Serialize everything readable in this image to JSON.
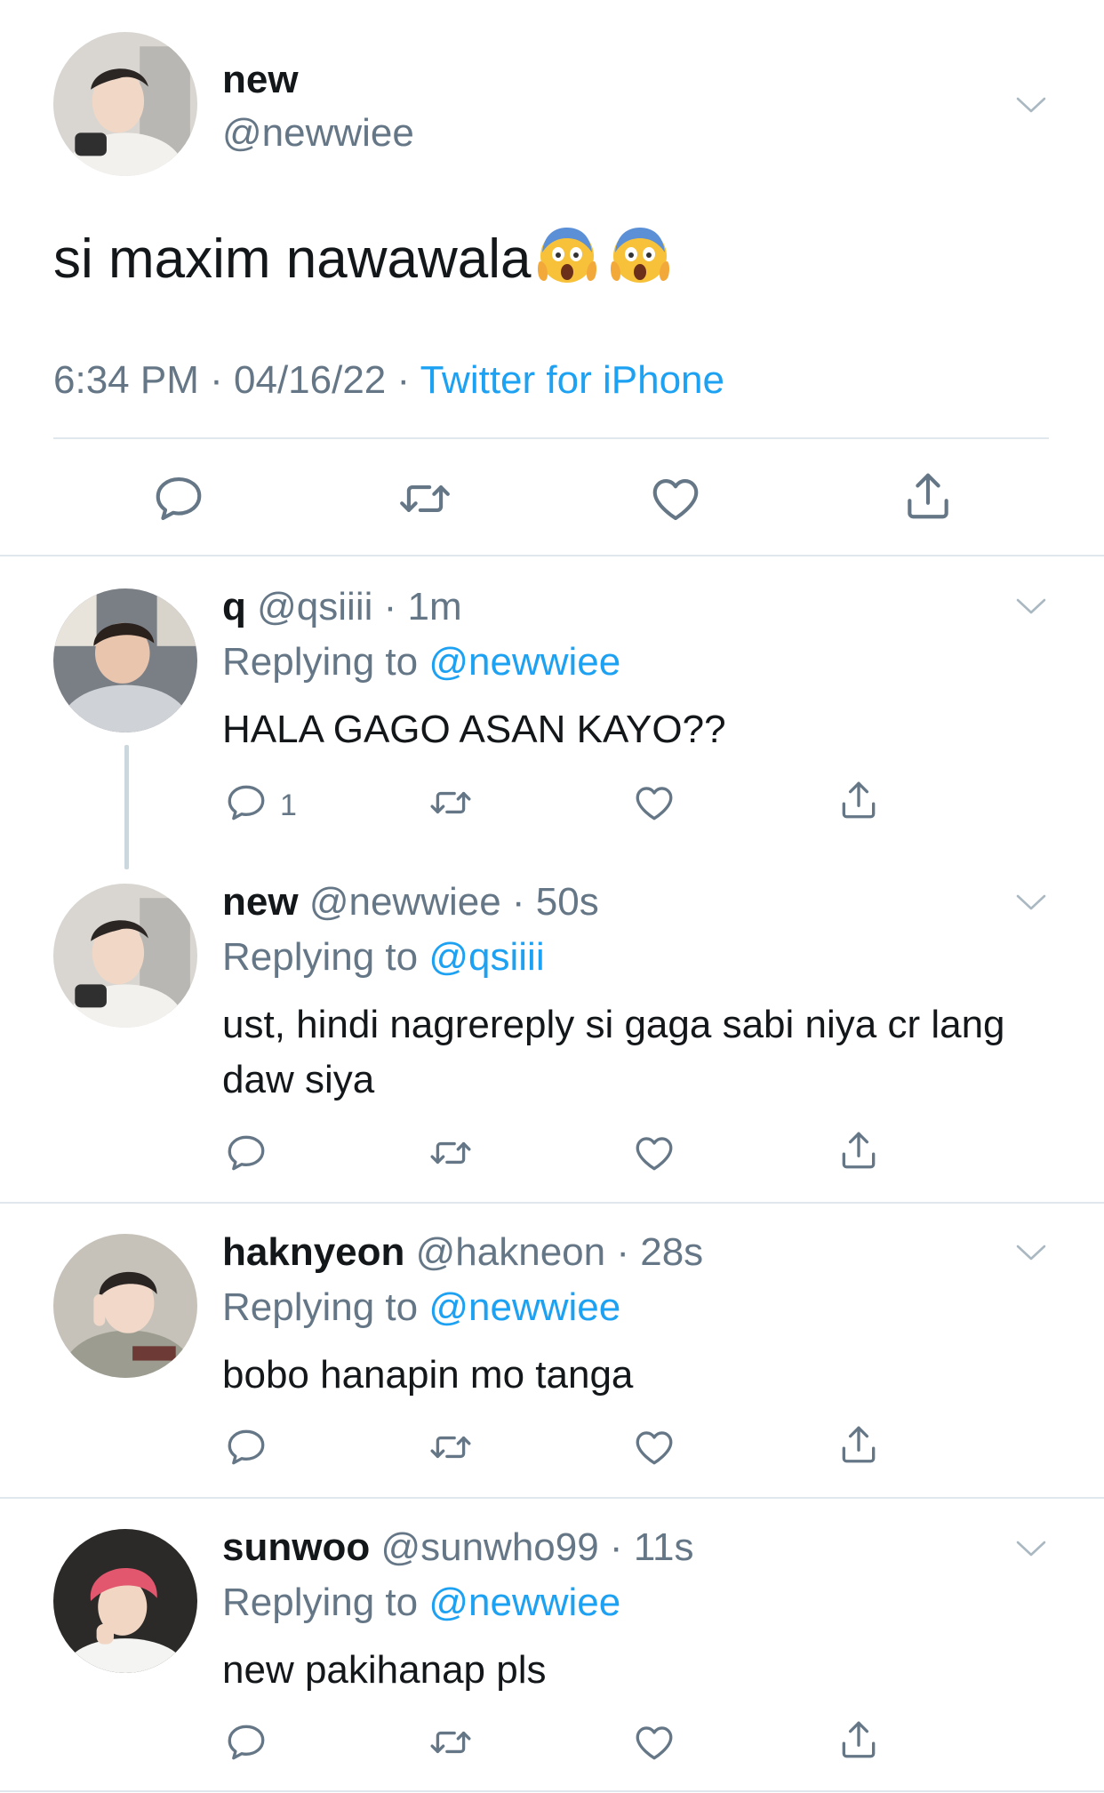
{
  "main_tweet": {
    "name": "new",
    "handle": "@newwiee",
    "text": "si maxim nawawala",
    "emojis": [
      "screaming-face-emoji",
      "screaming-face-emoji"
    ],
    "time": "6:34 PM",
    "date": "04/16/22",
    "separator": "·",
    "source": "Twitter for iPhone"
  },
  "replies": [
    {
      "name": "q",
      "handle": "@qsiiii",
      "age": "1m",
      "replying_label": "Replying to ",
      "replying_to": "@newwiee",
      "text": "HALA GAGO ASAN KAYO??",
      "reply_count": "1"
    },
    {
      "name": "new",
      "handle": "@newwiee",
      "age": "50s",
      "replying_label": "Replying to ",
      "replying_to": "@qsiiii",
      "text": "ust, hindi nagrereply si gaga sabi niya cr lang daw siya",
      "reply_count": ""
    },
    {
      "name": "haknyeon",
      "handle": "@hakneon",
      "age": "28s",
      "replying_label": "Replying to ",
      "replying_to": "@newwiee",
      "text": "bobo hanapin mo tanga",
      "reply_count": ""
    },
    {
      "name": "sunwoo",
      "handle": "@sunwho99",
      "age": "11s",
      "replying_label": "Replying to ",
      "replying_to": "@newwiee",
      "text": "new pakihanap pls",
      "reply_count": ""
    }
  ],
  "colors": {
    "link": "#1da1f2",
    "secondary": "#657786",
    "divider": "#e1e8ed",
    "text": "#14171a"
  },
  "icons": [
    "reply-icon",
    "retweet-icon",
    "like-icon",
    "share-icon",
    "chevron-down-icon"
  ]
}
